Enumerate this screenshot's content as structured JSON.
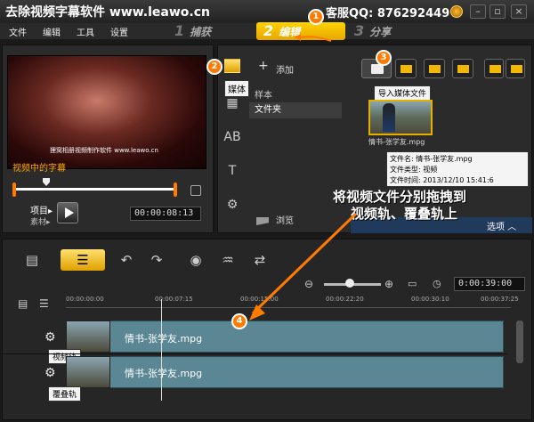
{
  "titlebar": {
    "title": "去除视频字幕软件 www.leawo.cn",
    "contact": "客服QQ: 876292449",
    "minimize": "–",
    "restore": "▫",
    "close": "×"
  },
  "menu": [
    "文件",
    "编辑",
    "工具",
    "设置"
  ],
  "steps": [
    {
      "num": "1",
      "label": "捕获"
    },
    {
      "num": "2",
      "label": "编辑"
    },
    {
      "num": "3",
      "label": "分享"
    }
  ],
  "preview": {
    "subtitle_text": "狸窝相册视频制作软件 www.leawo.cn",
    "video_label": "视频中的字幕",
    "mode_project": "项目▸",
    "mode_clip": "素材▸",
    "timecode": "00:00:08:13"
  },
  "library": {
    "media_tooltip": "媒体",
    "add_label": "添加",
    "folders": [
      "样本",
      "文件夹"
    ],
    "browse_label": "浏览",
    "import_tooltip": "导入媒体文件",
    "thumb_label": "情书-张学友.mpg",
    "file_info": {
      "name": "文件名: 情书-张学友.mpg",
      "type": "文件类型: 视频",
      "time": "文件时间: 2013/12/10 15:41:6"
    },
    "options_label": "选项 ︿"
  },
  "annotation": {
    "line1": "将视频文件分别拖拽到",
    "line2": "视频轨、覆叠轨上",
    "callouts": [
      "1",
      "2",
      "3",
      "4"
    ]
  },
  "timeline": {
    "total_time": "0:00:39:00",
    "ruler": [
      "00:00:00:00",
      "00:00:07:15",
      "00:00:15:00",
      "00:00:22:20",
      "00:00:30:10",
      "00:00:37:25"
    ],
    "tracks": [
      {
        "clip_label": "情书-张学友.mpg",
        "tooltip": "视频轨"
      },
      {
        "clip_label": "情书-张学友.mpg",
        "tooltip": "覆叠轨"
      }
    ]
  },
  "colors": {
    "accent": "#ffd400",
    "callout": "#ff7a00",
    "track": "#5a8793"
  }
}
